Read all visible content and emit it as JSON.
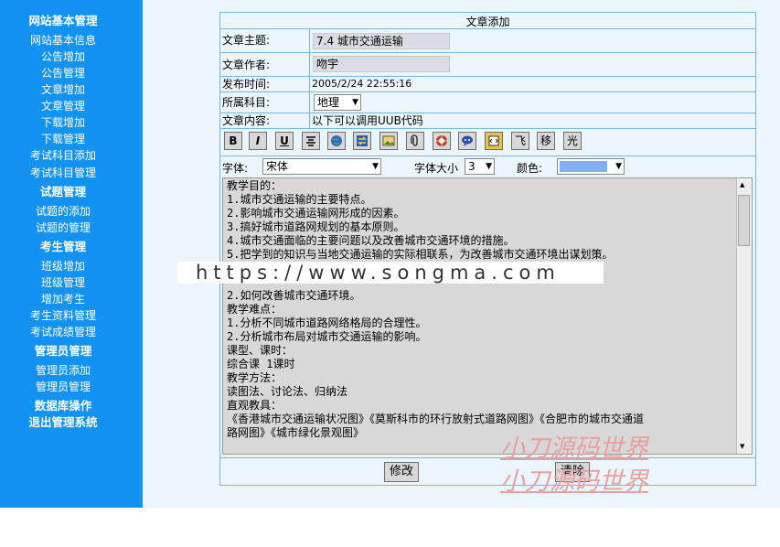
{
  "sidebar": {
    "items": [
      {
        "label": "网站基本管理",
        "bold": true
      },
      {
        "label": "网站基本信息",
        "bold": false
      },
      {
        "label": "公告增加",
        "bold": false
      },
      {
        "label": "公告管理",
        "bold": false
      },
      {
        "label": "文章增加",
        "bold": false
      },
      {
        "label": "文章管理",
        "bold": false
      },
      {
        "label": "下载增加",
        "bold": false
      },
      {
        "label": "下载管理",
        "bold": false
      },
      {
        "label": "考试科目添加",
        "bold": false
      },
      {
        "label": "考试科目管理",
        "bold": false
      },
      {
        "label": "试题管理",
        "bold": true
      },
      {
        "label": "试题的添加",
        "bold": false
      },
      {
        "label": "试题的管理",
        "bold": false
      },
      {
        "label": "考生管理",
        "bold": true
      },
      {
        "label": "班级增加",
        "bold": false
      },
      {
        "label": "班级管理",
        "bold": false
      },
      {
        "label": "增加考生",
        "bold": false
      },
      {
        "label": "考生资料管理",
        "bold": false
      },
      {
        "label": "考试成绩管理",
        "bold": false
      },
      {
        "label": "管理员管理",
        "bold": true
      },
      {
        "label": "管理员添加",
        "bold": false
      },
      {
        "label": "管理员管理",
        "bold": false
      },
      {
        "label": "数据库操作",
        "bold": true
      },
      {
        "label": "退出管理系统",
        "bold": true
      }
    ]
  },
  "form": {
    "title": "文章添加",
    "subject_label": "文章主题:",
    "subject_value": "7.4 城市交通运输",
    "author_label": "文章作者:",
    "author_value": "吻宇",
    "time_label": "发布时间:",
    "time_value": "2005/2/24 22:55:16",
    "category_label": "所属科目:",
    "category_value": "地理",
    "content_label": "文章内容:",
    "ubb_hint": "以下可以调用UUB代码",
    "font_label": "字体:",
    "font_value": "宋体",
    "size_label": "字体大小",
    "size_value": "3",
    "color_label": "颜色:",
    "color_value": "#7fb0ef",
    "toolbar": [
      "B",
      "I",
      "U",
      "center-icon",
      "globe-icon",
      "swap-icon",
      "image-icon",
      "clip-icon",
      "flash-icon",
      "quote-icon",
      "code-icon",
      "飞",
      "移",
      "光"
    ],
    "content_lines": [
      "教学目的：",
      "1.城市交通运输的主要特点。",
      "2.影响城市交通运输网形成的因素。",
      "3.搞好城市道路网规划的基本原则。",
      "4.城市交通面临的主要问题以及改善城市交通环境的措施。",
      "5.把学到的知识与当地交通运输的实际相联系，为改善城市交通环境出谋划策。",
      "",
      "",
      "2.如何改善城市交通环境。",
      "教学难点：",
      "1.分析不同城市道路网络格局的合理性。",
      "2.分析城市布局对城市交通运输的影响。",
      "课型、课时：",
      "综合课 1课时",
      "教学方法：",
      "读图法、讨论法、归纳法",
      "直观教具：",
      "《香港城市交通运输状况图》《莫斯科市的环行放射式道路网图》《合肥市的城市交通道",
      "路网图》《城市绿化景观图》"
    ],
    "modify_button": "修改",
    "clear_button": "清除"
  },
  "watermarks": {
    "url": "https://www.songma.com",
    "cn": "小刀源码世界"
  }
}
